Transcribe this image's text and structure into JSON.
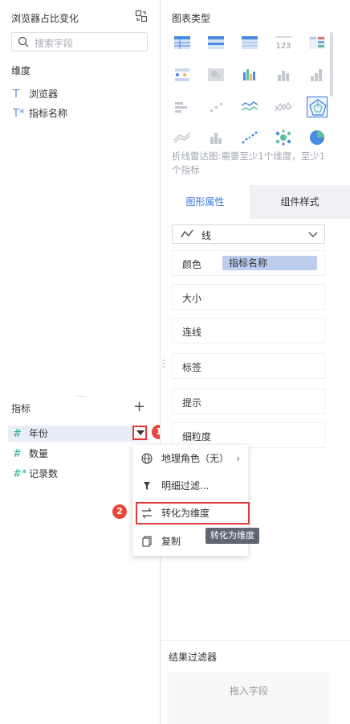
{
  "left": {
    "title": "浏览器占比变化",
    "search_placeholder": "搜索字段",
    "dimension_label": "维度",
    "dimensions": [
      {
        "type": "T",
        "name": "浏览器"
      },
      {
        "type": "T*",
        "name": "指标名称"
      }
    ],
    "measure_label": "指标",
    "measures": [
      {
        "type": "#",
        "name": "年份"
      },
      {
        "type": "#",
        "name": "数量"
      },
      {
        "type": "#*",
        "name": "记录数"
      }
    ],
    "add_symbol": "+"
  },
  "badges": {
    "one": "1",
    "two": "2"
  },
  "menu": {
    "items": [
      {
        "icon": "globe-icon",
        "label": "地理角色（无）",
        "has_submenu": true
      },
      {
        "icon": "filter-icon",
        "label": "明细过滤..."
      },
      {
        "icon": "swap-icon",
        "label": "转化为维度"
      },
      {
        "icon": "copy-icon",
        "label": "复制"
      }
    ],
    "tooltip": "转化为维度"
  },
  "right": {
    "chart_type_title": "图表类型",
    "chart_icons": [
      "table-icon",
      "crosstab-icon",
      "detail-table-icon",
      "number-icon",
      "colored-table-icon",
      "scatter-table-icon",
      "heat-map-icon",
      "multi-bar-icon",
      "bar-chart-icon",
      "column-chart-icon",
      "stacked-bar-icon",
      "small-scatter-icon",
      "line-chart-icon",
      "area-line-icon",
      "radar-icon",
      "range-area-icon",
      "grouped-bar-icon",
      "scatter-icon",
      "bubble-icon",
      "pie-icon"
    ],
    "selected_chart": "radar-icon",
    "hint": "折线雷达图:需要至少1个维度，至少1个指标",
    "tabs": [
      {
        "label": "图形属性",
        "active": true
      },
      {
        "label": "组件样式",
        "active": false
      }
    ],
    "mark_type": "线",
    "properties": [
      {
        "label": "颜色",
        "chip": "指标名称"
      },
      {
        "label": "大小"
      },
      {
        "label": "连线"
      },
      {
        "label": "标签"
      },
      {
        "label": "提示"
      },
      {
        "label": "细粒度"
      }
    ],
    "result_filter_title": "结果过滤器",
    "drop_hint": "拖入字段"
  },
  "colors": {
    "accent": "#3b7ae0",
    "highlight_red": "#e23b3b",
    "field_teal": "#2fae9a",
    "chip": "#bccdee"
  }
}
